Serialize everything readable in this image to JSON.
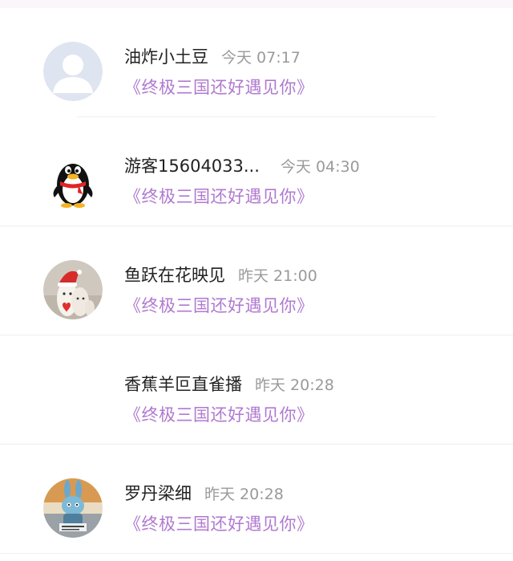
{
  "entries": [
    {
      "name": "油炸小土豆",
      "time": "今天 07:17",
      "game": "《终极三国还好遇见你》",
      "avatar": "default-person-icon"
    },
    {
      "name": "游客15604033...",
      "time": "今天 04:30",
      "game": "《终极三国还好遇见你》",
      "avatar": "qq-penguin-icon"
    },
    {
      "name": "鱼跃在花映见",
      "time": "昨天 21:00",
      "game": "《终极三国还好遇见你》",
      "avatar": "christmas-avatar"
    },
    {
      "name": "香蕉羊叵直雀播",
      "time": "昨天 20:28",
      "game": "《终极三国还好遇见你》",
      "avatar": "none"
    },
    {
      "name": "罗丹梁细",
      "time": "昨天 20:28",
      "game": "《终极三国还好遇见你》",
      "avatar": "cartoon-rabbit-avatar"
    }
  ],
  "colors": {
    "game_link": "#b07ad0",
    "time": "#9a9a9a",
    "name": "#222222"
  }
}
